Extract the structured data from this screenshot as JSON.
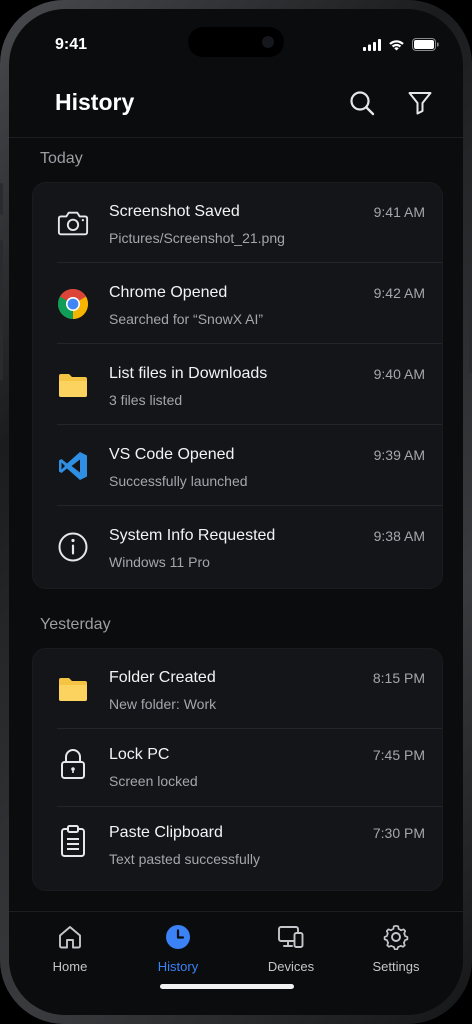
{
  "status": {
    "time": "9:41"
  },
  "header": {
    "title": "History"
  },
  "sections": [
    {
      "label": "Today",
      "items": [
        {
          "icon": "camera-icon",
          "title": "Screenshot Saved",
          "subtitle": "Pictures/Screenshot_21.png",
          "time": "9:41 AM"
        },
        {
          "icon": "chrome-icon",
          "title": "Chrome Opened",
          "subtitle": "Searched for “SnowX AI”",
          "time": "9:42 AM"
        },
        {
          "icon": "folder-icon",
          "title": "List files in Downloads",
          "subtitle": "3 files listed",
          "time": "9:40 AM"
        },
        {
          "icon": "vscode-icon",
          "title": "VS Code Opened",
          "subtitle": "Successfully launched",
          "time": "9:39 AM"
        },
        {
          "icon": "info-icon",
          "title": "System Info Requested",
          "subtitle": "Windows 11 Pro",
          "time": "9:38 AM"
        }
      ]
    },
    {
      "label": "Yesterday",
      "items": [
        {
          "icon": "folder-icon",
          "title": "Folder Created",
          "subtitle": "New folder: Work",
          "time": "8:15 PM"
        },
        {
          "icon": "lock-icon",
          "title": "Lock PC",
          "subtitle": "Screen locked",
          "time": "7:45 PM"
        },
        {
          "icon": "clipboard-icon",
          "title": "Paste Clipboard",
          "subtitle": "Text pasted successfully",
          "time": "7:30 PM"
        }
      ]
    }
  ],
  "tabs": [
    {
      "label": "Home",
      "icon": "home-icon",
      "active": false
    },
    {
      "label": "History",
      "icon": "clock-icon",
      "active": true
    },
    {
      "label": "Devices",
      "icon": "devices-icon",
      "active": false
    },
    {
      "label": "Settings",
      "icon": "gear-icon",
      "active": false
    }
  ],
  "colors": {
    "accent": "#3b82f6",
    "background": "#0b0c0d",
    "card": "#141518",
    "folder": "#f6c443",
    "vscode": "#2f8fe3"
  }
}
